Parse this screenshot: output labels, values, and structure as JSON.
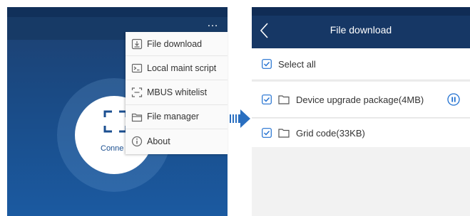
{
  "left_screen": {
    "more_label": "…",
    "connect_label": "Conne",
    "menu": {
      "items": [
        {
          "label": "File download",
          "icon": "download-icon"
        },
        {
          "label": "Local maint script",
          "icon": "terminal-icon"
        },
        {
          "label": "MBUS whitelist",
          "icon": "list-frame-icon"
        },
        {
          "label": "File manager",
          "icon": "folder-icon"
        },
        {
          "label": "About",
          "icon": "info-icon"
        }
      ]
    }
  },
  "right_screen": {
    "title": "File download",
    "select_all_label": "Select all",
    "items": [
      {
        "label": "Device upgrade package(4MB)",
        "checked": true,
        "status": "pause"
      },
      {
        "label": "Grid code(33KB)",
        "checked": true
      }
    ]
  },
  "colors": {
    "header_navy": "#163765",
    "accent_blue": "#1f6fd0",
    "arrow_blue": "#2a6fc0"
  }
}
